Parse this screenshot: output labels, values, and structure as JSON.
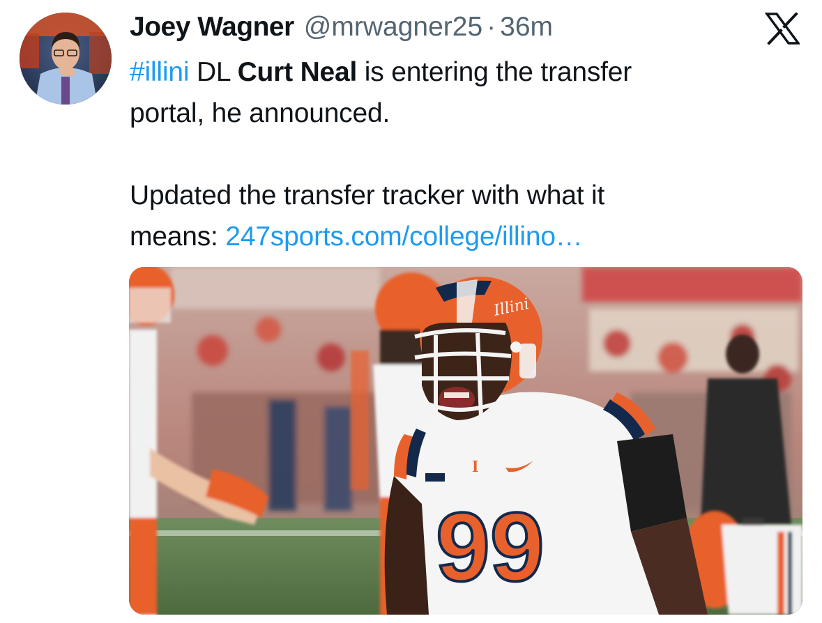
{
  "tweet": {
    "author": {
      "display_name": "Joey Wagner",
      "handle": "@mrwagner25",
      "avatar_icon": "avatar-photo"
    },
    "separator": "·",
    "time": "36m",
    "brand_icon": "x-logo-icon",
    "text": {
      "hashtag": "#illini",
      "line1_mid": " DL ",
      "player_name": "Curt Neal",
      "line1_end": " is entering the transfer",
      "line2": "portal, he announced.",
      "line3": "Updated the transfer tracker with what it",
      "line4_start": "means: ",
      "link": "247sports.com/college/illino…"
    },
    "media": {
      "type": "photo",
      "jersey_number": "99",
      "helmet_script": "Illini"
    }
  },
  "colors": {
    "link": "#1d9bf0",
    "secondary_text": "#536471",
    "primary_text": "#0f1419",
    "illini_orange": "#e8612c",
    "illini_navy": "#13294b"
  }
}
